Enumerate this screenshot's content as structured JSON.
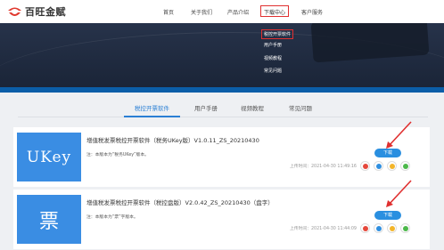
{
  "header": {
    "brand": "百旺金赋",
    "nav": [
      "首页",
      "关于我们",
      "产品介绍",
      "下载中心",
      "客户服务"
    ]
  },
  "dropdown": [
    "税控开票软件",
    "用户手册",
    "视频教程",
    "常见问题"
  ],
  "tabs": [
    "税控开票软件",
    "用户手册",
    "视频教程",
    "常见问题"
  ],
  "items": [
    {
      "thumb": "UKey",
      "title": "增值税发票税控开票软件（税务UKey版）V1.0.11_ZS_20210430",
      "note": "注：本版本为“税务UKey”版本。",
      "time": "上传时间：2021-04-30 11:49:16",
      "button": "下载"
    },
    {
      "thumb": "票",
      "title": "增值税发票税控开票软件（税控盘版）V2.0.42_ZS_20210430（盘字）",
      "note": "注：本版本为“票”字版本。",
      "time": "上传时间：2021-04-30 11:44:09",
      "button": "下载"
    }
  ],
  "colors": {
    "accent": "#2a8fe0",
    "highlight": "#e03030",
    "banner": "#1f2a3f"
  },
  "icons": [
    "weibo-icon",
    "qq-icon",
    "star-icon",
    "wechat-icon"
  ]
}
